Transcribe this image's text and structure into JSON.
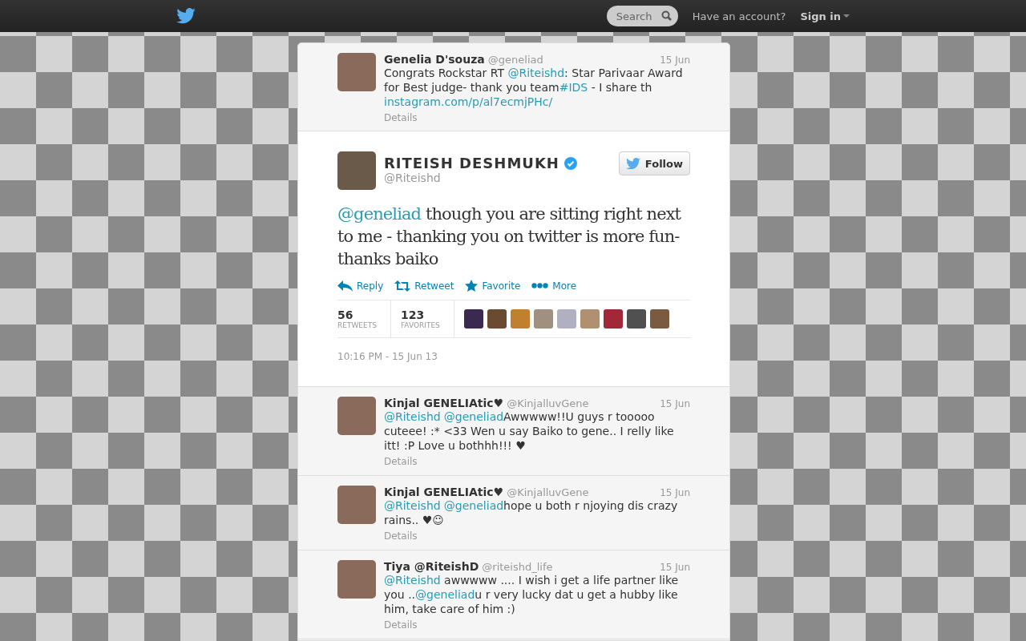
{
  "topbar": {
    "search": {
      "placeholder": "Search"
    },
    "account_prompt": "Have an account?",
    "sign_in": "Sign in"
  },
  "context_tweet": {
    "name": "Genelia D'souza",
    "handle": "@geneliad",
    "date": "15 Jun",
    "text": [
      {
        "kind": "text",
        "text": "Congrats Rockstar RT "
      },
      {
        "kind": "link",
        "text": "@Riteishd"
      },
      {
        "kind": "text",
        "text": ": Star Parivaar Award for Best judge- thank you team"
      },
      {
        "kind": "link",
        "text": "#IDS"
      },
      {
        "kind": "text",
        "text": " - I share th "
      },
      {
        "kind": "link",
        "text": "instagram.com/p/al7ecmjPHc/"
      }
    ],
    "details": "Details"
  },
  "main_tweet": {
    "name": "RITEISH DESHMUKH",
    "verified": true,
    "handle": "@Riteishd",
    "follow": "Follow",
    "text": [
      {
        "kind": "link",
        "text": "@geneliad"
      },
      {
        "kind": "text",
        "text": "  though you are sitting right next to me - thanking you on twitter is more fun- thanks baiko"
      }
    ],
    "actions": [
      {
        "kind": "reply",
        "label": "Reply"
      },
      {
        "kind": "retweet",
        "label": "Retweet"
      },
      {
        "kind": "favorite",
        "label": "Favorite"
      },
      {
        "kind": "more",
        "label": "More"
      }
    ],
    "stats": [
      {
        "count": "56",
        "label": "RETWEETS"
      },
      {
        "count": "123",
        "label": "FAVORITES"
      }
    ],
    "favoriters": [
      {
        "color": "#3a2a50"
      },
      {
        "color": "#6a4a30"
      },
      {
        "color": "#c08030"
      },
      {
        "color": "#a09080"
      },
      {
        "color": "#b0b0c0"
      },
      {
        "color": "#b09070"
      },
      {
        "color": "#a02838"
      },
      {
        "color": "#505050"
      },
      {
        "color": "#7a5a40"
      }
    ],
    "timestamp": "10:16 PM - 15 Jun 13"
  },
  "replies": [
    {
      "name": "Kinjal GENELIAtic♥",
      "handle": "@KinjalluvGene",
      "date": "15 Jun",
      "text": [
        {
          "kind": "link",
          "text": "@Riteishd"
        },
        {
          "kind": "link",
          "text": "@geneliad"
        },
        {
          "kind": "text",
          "text": "Awwwww!!U guys r tooooo cuteee! :* <33 Wen u say Baiko to gene.. I relly like itt! :P Love u bothhh!!! ♥"
        }
      ],
      "details": "Details"
    },
    {
      "name": "Kinjal GENELIAtic♥",
      "handle": "@KinjalluvGene",
      "date": "15 Jun",
      "text": [
        {
          "kind": "link",
          "text": "@Riteishd"
        },
        {
          "kind": "link",
          "text": "@geneliad"
        },
        {
          "kind": "text",
          "text": "hope u both r njoying dis crazy rains.. ♥☺"
        }
      ],
      "details": "Details"
    },
    {
      "name": "Tiya @RiteishD",
      "handle": "@riteishd_life",
      "date": "15 Jun",
      "text": [
        {
          "kind": "link",
          "text": "@Riteishd"
        },
        {
          "kind": "text",
          "text": " awwwww .... I wish i get a life partner like you .."
        },
        {
          "kind": "link",
          "text": "@geneliad"
        },
        {
          "kind": "text",
          "text": "u r very lucky dat u get a hubby like him, take care of him :)"
        }
      ],
      "details": "Details"
    }
  ]
}
